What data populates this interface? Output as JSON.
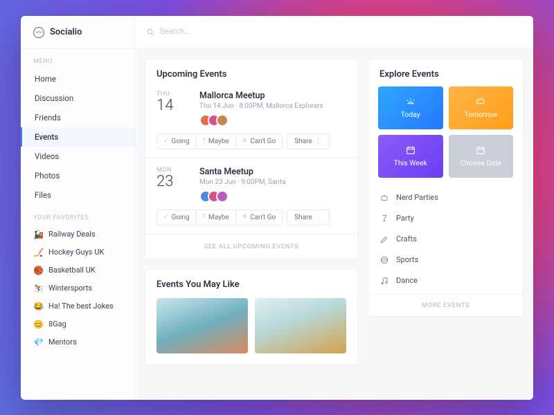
{
  "brand": {
    "name": "Socialio"
  },
  "search": {
    "placeholder": "Search..."
  },
  "sidebar": {
    "menu_label": "MENU",
    "items": [
      {
        "label": "Home"
      },
      {
        "label": "Discussion"
      },
      {
        "label": "Friends"
      },
      {
        "label": "Events"
      },
      {
        "label": "Videos"
      },
      {
        "label": "Photos"
      },
      {
        "label": "Files"
      }
    ],
    "fav_label": "YOUR FAVORITES",
    "favorites": [
      {
        "emoji": "🚂",
        "label": "Railway Deals"
      },
      {
        "emoji": "🏒",
        "label": "Hockey Guys UK"
      },
      {
        "emoji": "🏀",
        "label": "Basketball UK"
      },
      {
        "emoji": "⛷️",
        "label": "Wintersports"
      },
      {
        "emoji": "😂",
        "label": "Ha! The best Jokes"
      },
      {
        "emoji": "😊",
        "label": "8Gag"
      },
      {
        "emoji": "💎",
        "label": "Mentors"
      }
    ]
  },
  "upcoming": {
    "title": "Upcoming Events",
    "events": [
      {
        "day": "THU",
        "num": "14",
        "title": "Mallorca Meetup",
        "meta": "Thu 14 Jun · 8:00PM, Mallorca Explorers"
      },
      {
        "day": "MON",
        "num": "23",
        "title": "Santa Meetup",
        "meta": "Mon 23 Jun · 9:00PM, Santa"
      }
    ],
    "rsvp": {
      "going": "Going",
      "maybe": "Maybe",
      "cant": "Can't Go",
      "share": "Share"
    },
    "see_all": "SEE ALL UPCOMING EVENTS"
  },
  "maylike": {
    "title": "Events You May Like"
  },
  "explore": {
    "title": "Explore Events",
    "tiles": {
      "today": "Today",
      "tomorrow": "Tomorrow",
      "week": "This Week",
      "choose": "Choose Date"
    },
    "cats": [
      {
        "label": "Nerd Parties"
      },
      {
        "label": "Party"
      },
      {
        "label": "Crafts"
      },
      {
        "label": "Sports"
      },
      {
        "label": "Dance"
      }
    ],
    "more": "MORE EVENTS"
  },
  "avatar_colors": [
    "#e06d4e",
    "#d94f86",
    "#c6884e"
  ]
}
